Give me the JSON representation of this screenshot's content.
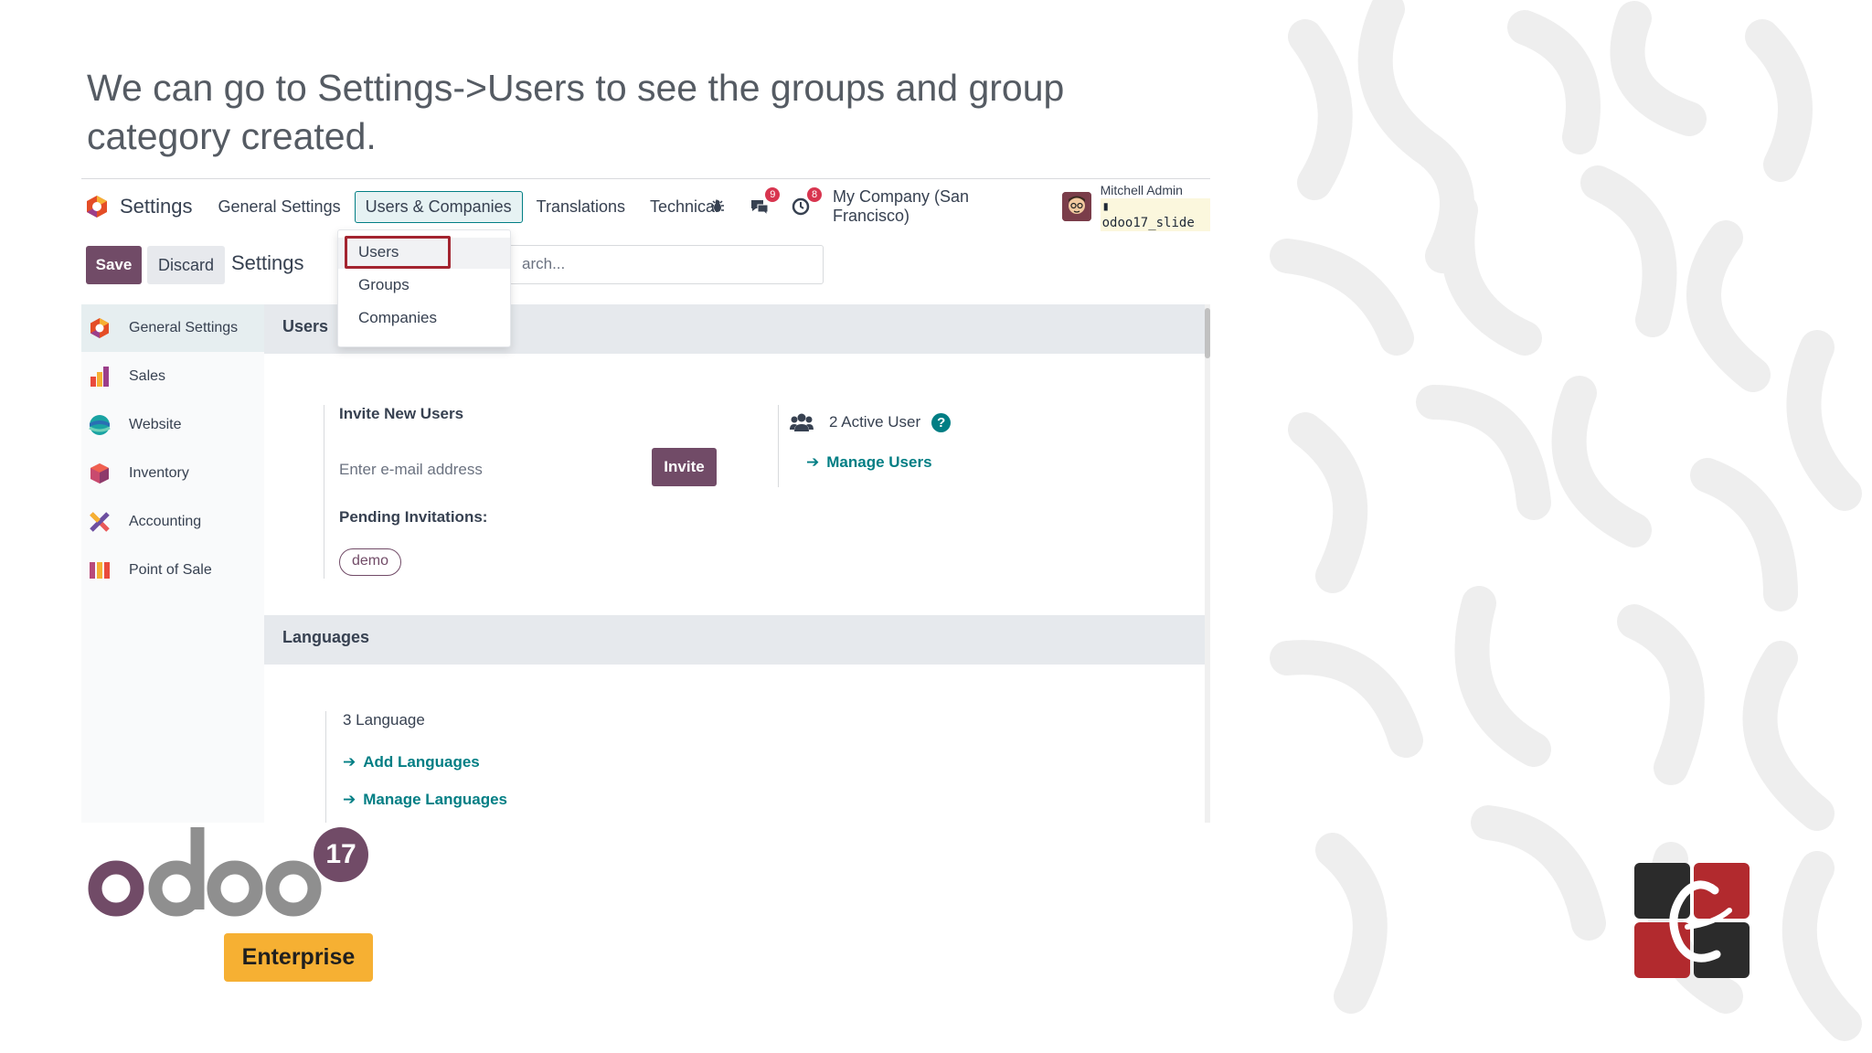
{
  "slide": {
    "title": "We can go to Settings->Users to see the groups and group category created."
  },
  "navbar": {
    "app_name": "Settings",
    "menu": [
      "General Settings",
      "Users & Companies",
      "Translations",
      "Technical"
    ],
    "active_menu": "Users & Companies",
    "messages_badge": "9",
    "activities_badge": "8",
    "company": "My Company (San Francisco)",
    "user_name": "Mitchell Admin",
    "database": "odoo17_slide"
  },
  "dropdown": {
    "items": [
      "Users",
      "Groups",
      "Companies"
    ],
    "highlighted": "Users"
  },
  "control": {
    "save_label": "Save",
    "discard_label": "Discard",
    "breadcrumb": "Settings",
    "search_placeholder": "arch..."
  },
  "sidebar": {
    "items": [
      {
        "label": "General Settings",
        "icon": "settings-app-icon",
        "color": "#e44d26"
      },
      {
        "label": "Sales",
        "icon": "sales-app-icon",
        "color": "#f06050"
      },
      {
        "label": "Website",
        "icon": "website-app-icon",
        "color": "#1aa3a3"
      },
      {
        "label": "Inventory",
        "icon": "inventory-app-icon",
        "color": "#c94a6e"
      },
      {
        "label": "Accounting",
        "icon": "accounting-app-icon",
        "color": "#e95959"
      },
      {
        "label": "Point of Sale",
        "icon": "pos-app-icon",
        "color": "#b84a7a"
      }
    ]
  },
  "users_section": {
    "heading": "Users",
    "invite_title": "Invite New Users",
    "email_placeholder": "Enter e-mail address",
    "invite_label": "Invite",
    "pending_label": "Pending Invitations:",
    "pending_users": [
      "demo"
    ],
    "active_users": "2 Active User",
    "manage_users": "Manage Users"
  },
  "languages_section": {
    "heading": "Languages",
    "count": "3 Language",
    "add_languages": "Add Languages",
    "manage_languages": "Manage Languages"
  },
  "branding": {
    "odoo_word": "odoo",
    "version": "17",
    "edition": "Enterprise",
    "primary_color": "#714b67",
    "accent_color": "#017e84"
  }
}
